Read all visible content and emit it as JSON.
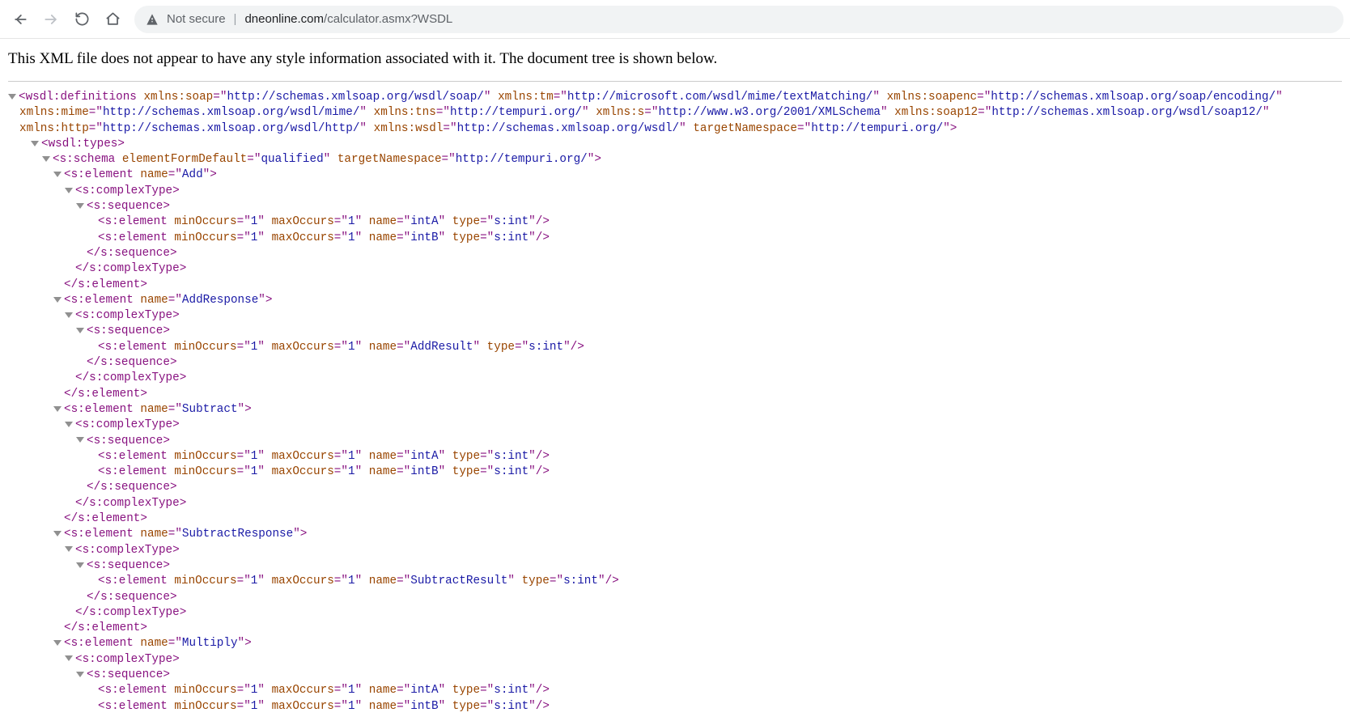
{
  "toolbar": {
    "security_label": "Not secure",
    "url_host": "dneonline.com",
    "url_path": "/calculator.asmx?WSDL"
  },
  "banner": "This XML file does not appear to have any style information associated with it. The document tree is shown below.",
  "xml": {
    "definitions": {
      "tag": "wsdl:definitions",
      "attrs": {
        "xmlns:soap": "http://schemas.xmlsoap.org/wsdl/soap/",
        "xmlns:tm": "http://microsoft.com/wsdl/mime/textMatching/",
        "xmlns:soapenc": "http://schemas.xmlsoap.org/soap/encoding/",
        "xmlns:mime": "http://schemas.xmlsoap.org/wsdl/mime/",
        "xmlns:tns": "http://tempuri.org/",
        "xmlns:s": "http://www.w3.org/2001/XMLSchema",
        "xmlns:soap12": "http://schemas.xmlsoap.org/wsdl/soap12/",
        "xmlns:http": "http://schemas.xmlsoap.org/wsdl/http/",
        "xmlns:wsdl": "http://schemas.xmlsoap.org/wsdl/",
        "targetNamespace": "http://tempuri.org/"
      }
    },
    "types_tag": "wsdl:types",
    "schema": {
      "tag": "s:schema",
      "elementFormDefault": "qualified",
      "targetNamespace": "http://tempuri.org/"
    },
    "complexType_tag": "s:complexType",
    "sequence_tag": "s:sequence",
    "element_tag": "s:element",
    "close_sequence": "</s:sequence>",
    "close_complexType": "</s:complexType>",
    "close_element": "</s:element>",
    "elements": [
      {
        "name": "Add",
        "children": [
          {
            "minOccurs": "1",
            "maxOccurs": "1",
            "name": "intA",
            "type": "s:int"
          },
          {
            "minOccurs": "1",
            "maxOccurs": "1",
            "name": "intB",
            "type": "s:int"
          }
        ]
      },
      {
        "name": "AddResponse",
        "children": [
          {
            "minOccurs": "1",
            "maxOccurs": "1",
            "name": "AddResult",
            "type": "s:int"
          }
        ]
      },
      {
        "name": "Subtract",
        "children": [
          {
            "minOccurs": "1",
            "maxOccurs": "1",
            "name": "intA",
            "type": "s:int"
          },
          {
            "minOccurs": "1",
            "maxOccurs": "1",
            "name": "intB",
            "type": "s:int"
          }
        ]
      },
      {
        "name": "SubtractResponse",
        "children": [
          {
            "minOccurs": "1",
            "maxOccurs": "1",
            "name": "SubtractResult",
            "type": "s:int"
          }
        ]
      },
      {
        "name": "Multiply",
        "children": [
          {
            "minOccurs": "1",
            "maxOccurs": "1",
            "name": "intA",
            "type": "s:int"
          },
          {
            "minOccurs": "1",
            "maxOccurs": "1",
            "name": "intB",
            "type": "s:int"
          }
        ]
      }
    ]
  }
}
